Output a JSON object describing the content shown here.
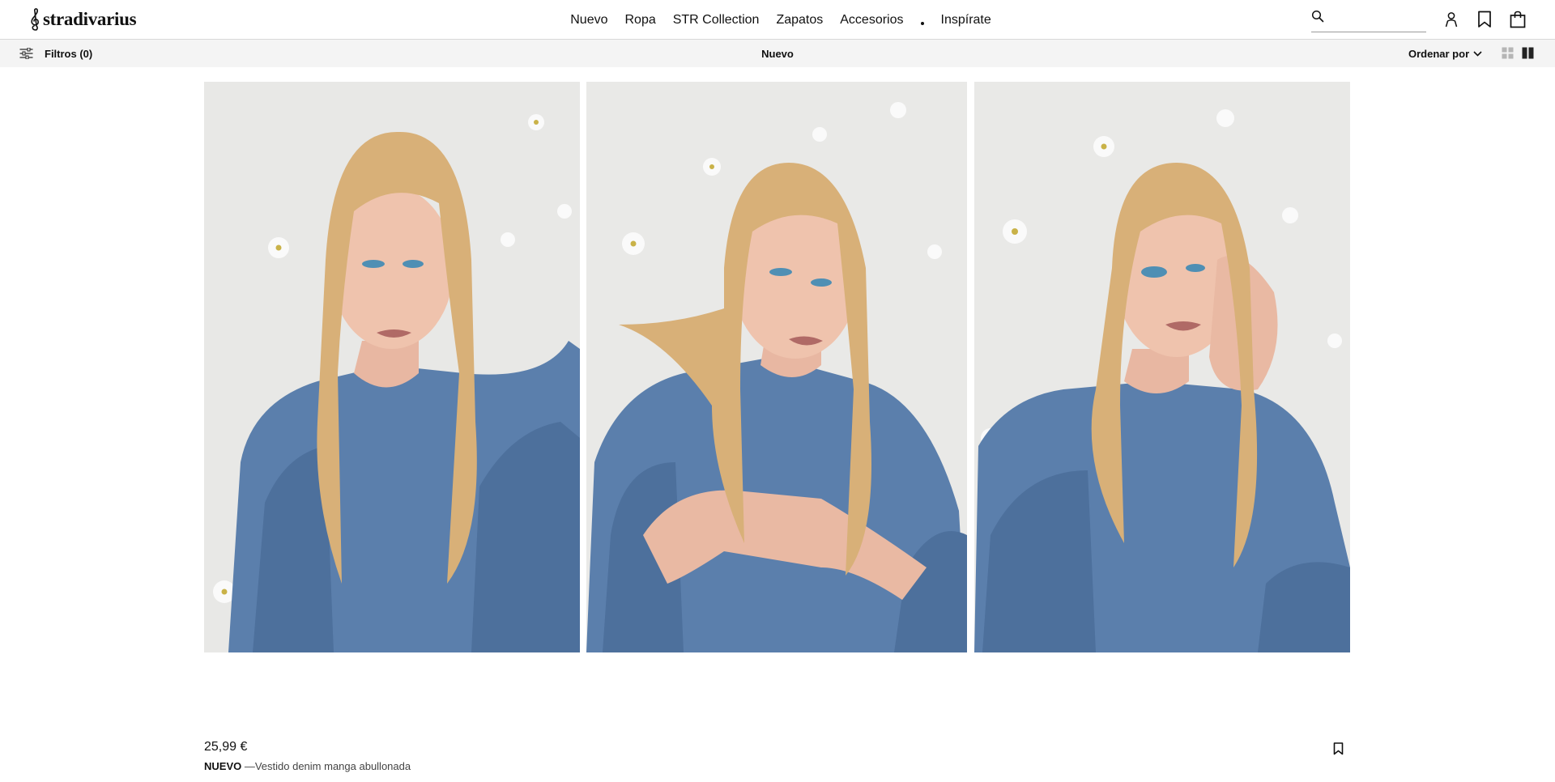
{
  "brand": {
    "name": "stradivarius"
  },
  "nav": {
    "items": [
      {
        "label": "Nuevo"
      },
      {
        "label": "Ropa"
      },
      {
        "label": "STR Collection"
      },
      {
        "label": "Zapatos"
      },
      {
        "label": "Accesorios"
      }
    ],
    "last_item": {
      "label": "Inspírate"
    }
  },
  "search": {
    "placeholder": "",
    "value": "",
    "icon": "search-icon"
  },
  "header_icons": [
    "user-icon",
    "bookmark-icon",
    "shopping-bag-icon"
  ],
  "toolbar": {
    "filters_label": "Filtros (0)",
    "filters_icon": "sliders-icon",
    "title": "Nuevo",
    "sort_label": "Ordenar por",
    "sort_icon": "chevron-down-icon",
    "view_options": [
      "grid-small-view",
      "grid-large-view"
    ],
    "active_view": "grid-large-view"
  },
  "product": {
    "price": "25,99 €",
    "tag": "NUEVO",
    "name": " —Vestido denim manga abullonada",
    "image_count": 3,
    "save_icon": "bookmark-icon"
  },
  "colors": {
    "text": "#111111",
    "toolbar_bg": "#f4f4f4",
    "denim": "#5b7fac",
    "hair": "#d8b078",
    "backdrop": "#e8e8e6"
  }
}
